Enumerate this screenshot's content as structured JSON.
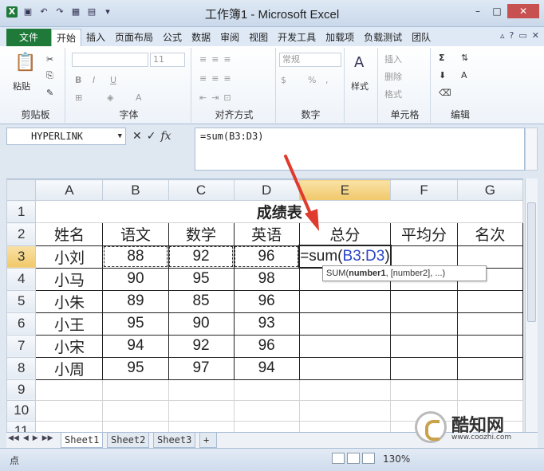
{
  "window": {
    "title": "工作簿1 - Microsoft Excel",
    "app_logo": "X",
    "controls": [
      "–",
      "□",
      "✕"
    ]
  },
  "ribbon_tabs": {
    "file": "文件",
    "tabs": [
      "开始",
      "插入",
      "页面布局",
      "公式",
      "数据",
      "审阅",
      "视图",
      "开发工具",
      "加载项",
      "负载测试",
      "团队"
    ],
    "active": "开始"
  },
  "ribbon": {
    "clipboard": {
      "label": "剪贴板",
      "paste": "粘贴"
    },
    "font": {
      "label": "字体",
      "size": "11",
      "bold": "B",
      "italic": "I",
      "underline": "U"
    },
    "alignment": {
      "label": "对齐方式"
    },
    "number": {
      "label": "数字",
      "format": "常规",
      "percent": "%",
      "comma": ","
    },
    "styles": {
      "label": "样式",
      "btn": "样式"
    },
    "cells": {
      "label": "单元格",
      "insert": "插入",
      "delete": "删除",
      "format": "格式"
    },
    "editing": {
      "label": "编辑",
      "sum": "Σ"
    }
  },
  "formula_bar": {
    "name_box": "HYPERLINK",
    "fx": "fx",
    "formula": "=sum(B3:D3)"
  },
  "grid": {
    "columns": [
      "A",
      "B",
      "C",
      "D",
      "E",
      "F",
      "G"
    ],
    "rows": [
      "1",
      "2",
      "3",
      "4",
      "5",
      "6",
      "7",
      "8",
      "9",
      "10",
      "11"
    ],
    "title": "成绩表",
    "headers": [
      "姓名",
      "语文",
      "数学",
      "英语",
      "总分",
      "平均分",
      "名次"
    ],
    "students": [
      {
        "name": "小刘",
        "chinese": "88",
        "math": "92",
        "english": "96"
      },
      {
        "name": "小马",
        "chinese": "90",
        "math": "95",
        "english": "98"
      },
      {
        "name": "小朱",
        "chinese": "89",
        "math": "85",
        "english": "96"
      },
      {
        "name": "小王",
        "chinese": "95",
        "math": "90",
        "english": "93"
      },
      {
        "name": "小宋",
        "chinese": "94",
        "math": "92",
        "english": "96"
      },
      {
        "name": "小周",
        "chinese": "95",
        "math": "97",
        "english": "94"
      }
    ],
    "active_cell": {
      "prefix": "=sum(",
      "ref_b": "B3",
      "colon": ":",
      "ref_d": "D3",
      "suffix": ")"
    }
  },
  "tooltip": {
    "fn": "SUM(",
    "arg1": "number1",
    "rest": ", [number2], ...)"
  },
  "sheets": [
    "Sheet1",
    "Sheet2",
    "Sheet3"
  ],
  "status": {
    "mode": "点",
    "zoom": "130%"
  },
  "watermark": {
    "name": "酷知网",
    "url": "www.coozhi.com"
  }
}
